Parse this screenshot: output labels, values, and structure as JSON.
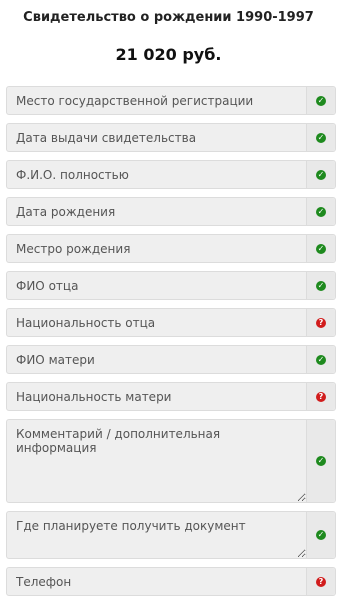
{
  "header": {
    "title": "Свидетельство о рождении 1990-1997",
    "price": "21 020 руб."
  },
  "colors": {
    "ok": "#1e8a1e",
    "error": "#d11c1c"
  },
  "fields": [
    {
      "placeholder": "Место государственной регистрации",
      "status": "ok",
      "icon": "check-icon"
    },
    {
      "placeholder": "Дата выдачи свидетельства",
      "status": "ok",
      "icon": "check-icon"
    },
    {
      "placeholder": "Ф.И.О. полностью",
      "status": "ok",
      "icon": "check-icon"
    },
    {
      "placeholder": "Дата рождения",
      "status": "ok",
      "icon": "check-icon"
    },
    {
      "placeholder": "Местро рождения",
      "status": "ok",
      "icon": "check-icon"
    },
    {
      "placeholder": "ФИО отца",
      "status": "ok",
      "icon": "check-icon"
    },
    {
      "placeholder": "Национальность отца",
      "status": "error",
      "icon": "question-icon"
    },
    {
      "placeholder": "ФИО матери",
      "status": "ok",
      "icon": "check-icon"
    },
    {
      "placeholder": "Национальность матери",
      "status": "error",
      "icon": "question-icon"
    },
    {
      "placeholder": "Комментарий / дополнительная информация",
      "status": "ok",
      "icon": "check-icon"
    },
    {
      "placeholder": "Где планируете получить документ",
      "status": "ok",
      "icon": "check-icon"
    },
    {
      "placeholder": "Телефон",
      "status": "error",
      "icon": "question-icon"
    }
  ]
}
